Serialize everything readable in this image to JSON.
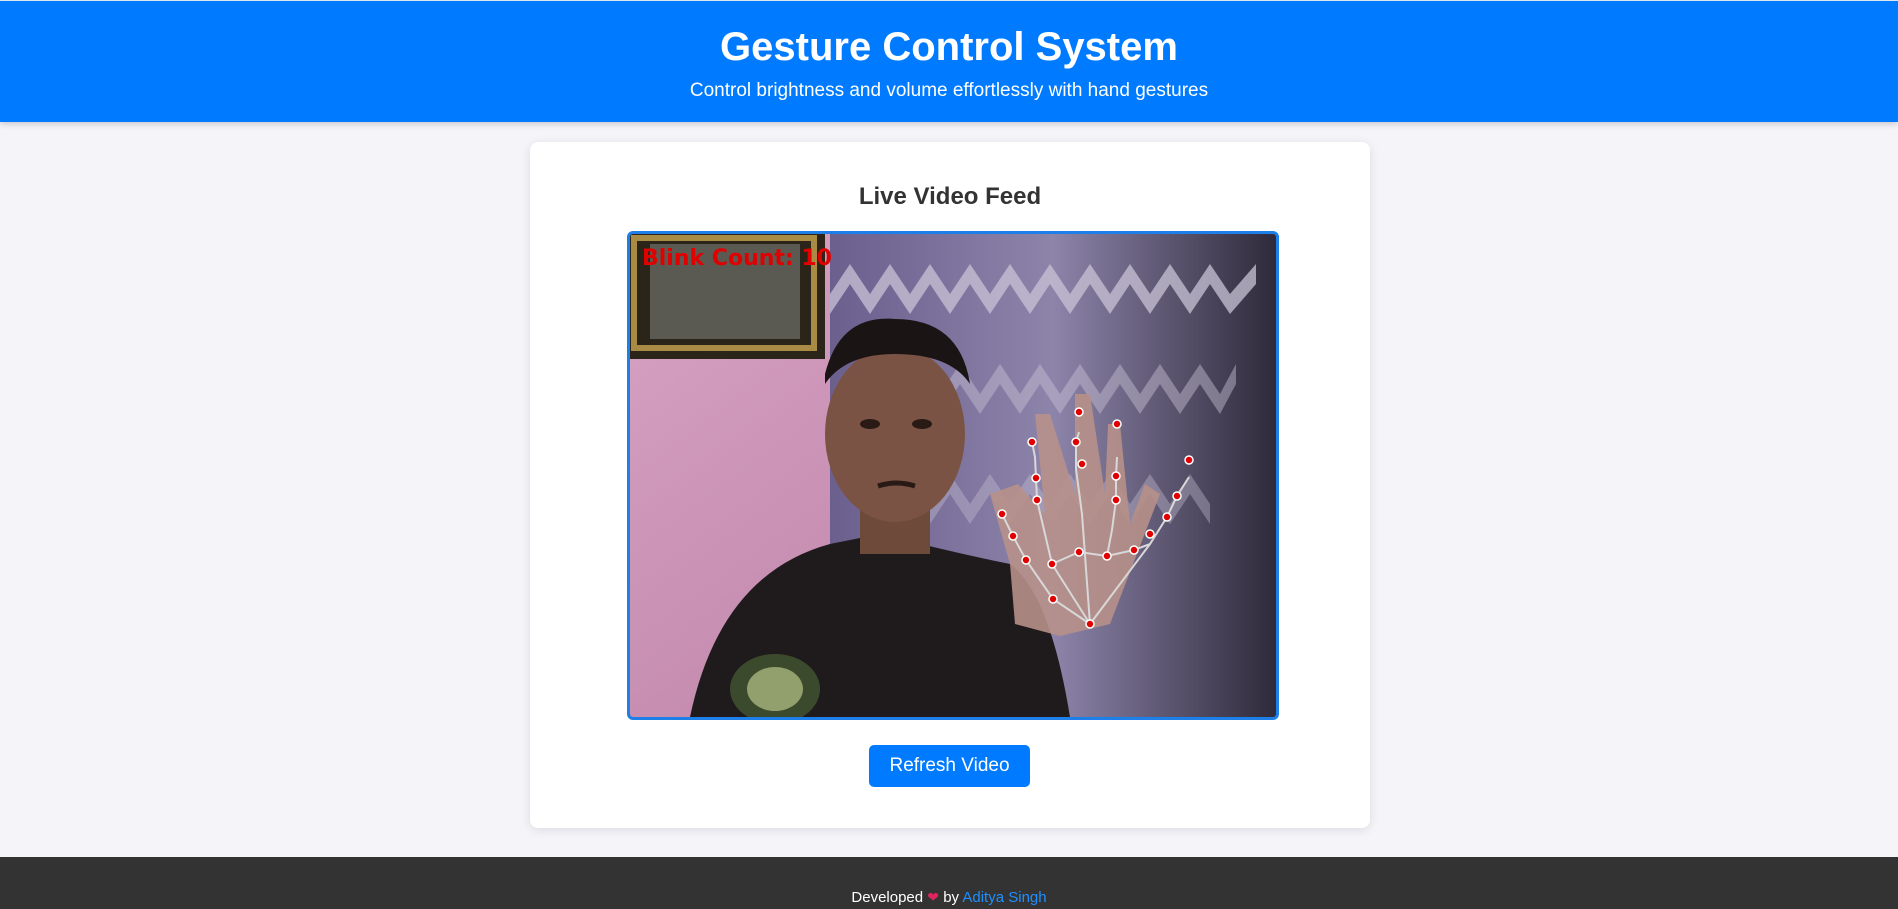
{
  "header": {
    "title": "Gesture Control System",
    "subtitle": "Control brightness and volume effortlessly with hand gestures"
  },
  "main": {
    "feed_title": "Live Video Feed",
    "video_overlay": "Blink Count: 10",
    "refresh_label": "Refresh Video"
  },
  "footer": {
    "developed": "Developed",
    "heart": "❤",
    "by": "by",
    "author": "Aditya Singh"
  },
  "colors": {
    "primary": "#007bff",
    "footer_bg": "#333333",
    "overlay_text": "#e00000",
    "link": "#1e90ff"
  }
}
